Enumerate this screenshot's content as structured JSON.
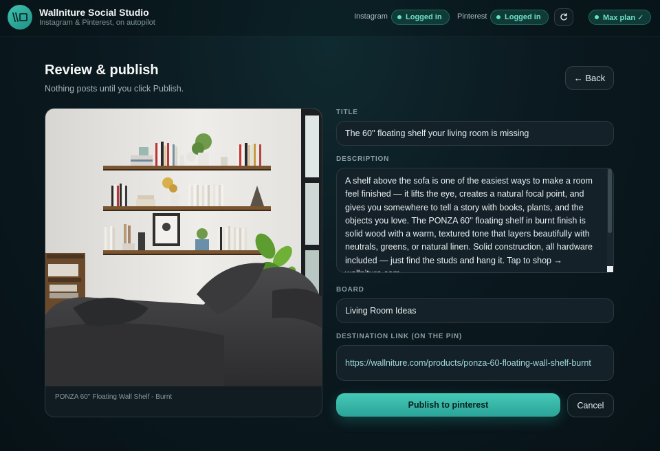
{
  "header": {
    "app_title": "Wallniture Social Studio",
    "tagline": "Instagram & Pinterest, on autopilot",
    "connections": [
      {
        "label": "Instagram",
        "status": "Logged in"
      },
      {
        "label": "Pinterest",
        "status": "Logged in"
      }
    ],
    "plan_label": "Max plan ✓"
  },
  "page": {
    "title": "Review & publish",
    "subtitle": "Nothing posts until you click Publish.",
    "back_label": "← Back"
  },
  "product": {
    "caption": "PONZA 60'' Floating Wall Shelf - Burnt"
  },
  "form": {
    "title_label": "TITLE",
    "title_value": "The 60'' floating shelf your living room is missing",
    "description_label": "DESCRIPTION",
    "description_value": "A shelf above the sofa is one of the easiest ways to make a room feel finished — it lifts the eye, creates a natural focal point, and gives you somewhere to tell a story with books, plants, and the objects you love. The PONZA 60'' floating shelf in burnt finish is solid wood with a warm, textured tone that layers beautifully with neutrals, greens, or natural linen. Solid construction, all hardware included — just find the studs and hang it. Tap to shop → wallniture.com",
    "board_label": "BOARD",
    "board_value": "Living Room Ideas",
    "link_label": "DESTINATION LINK (ON THE PIN)",
    "link_value": "https://wallniture.com/products/ponza-60-floating-wall-shelf-burnt"
  },
  "actions": {
    "publish_label": "Publish to pinterest",
    "cancel_label": "Cancel"
  },
  "colors": {
    "accent": "#3fc4b0",
    "status_green": "#6fe0c6",
    "background": "#0b1a20"
  }
}
